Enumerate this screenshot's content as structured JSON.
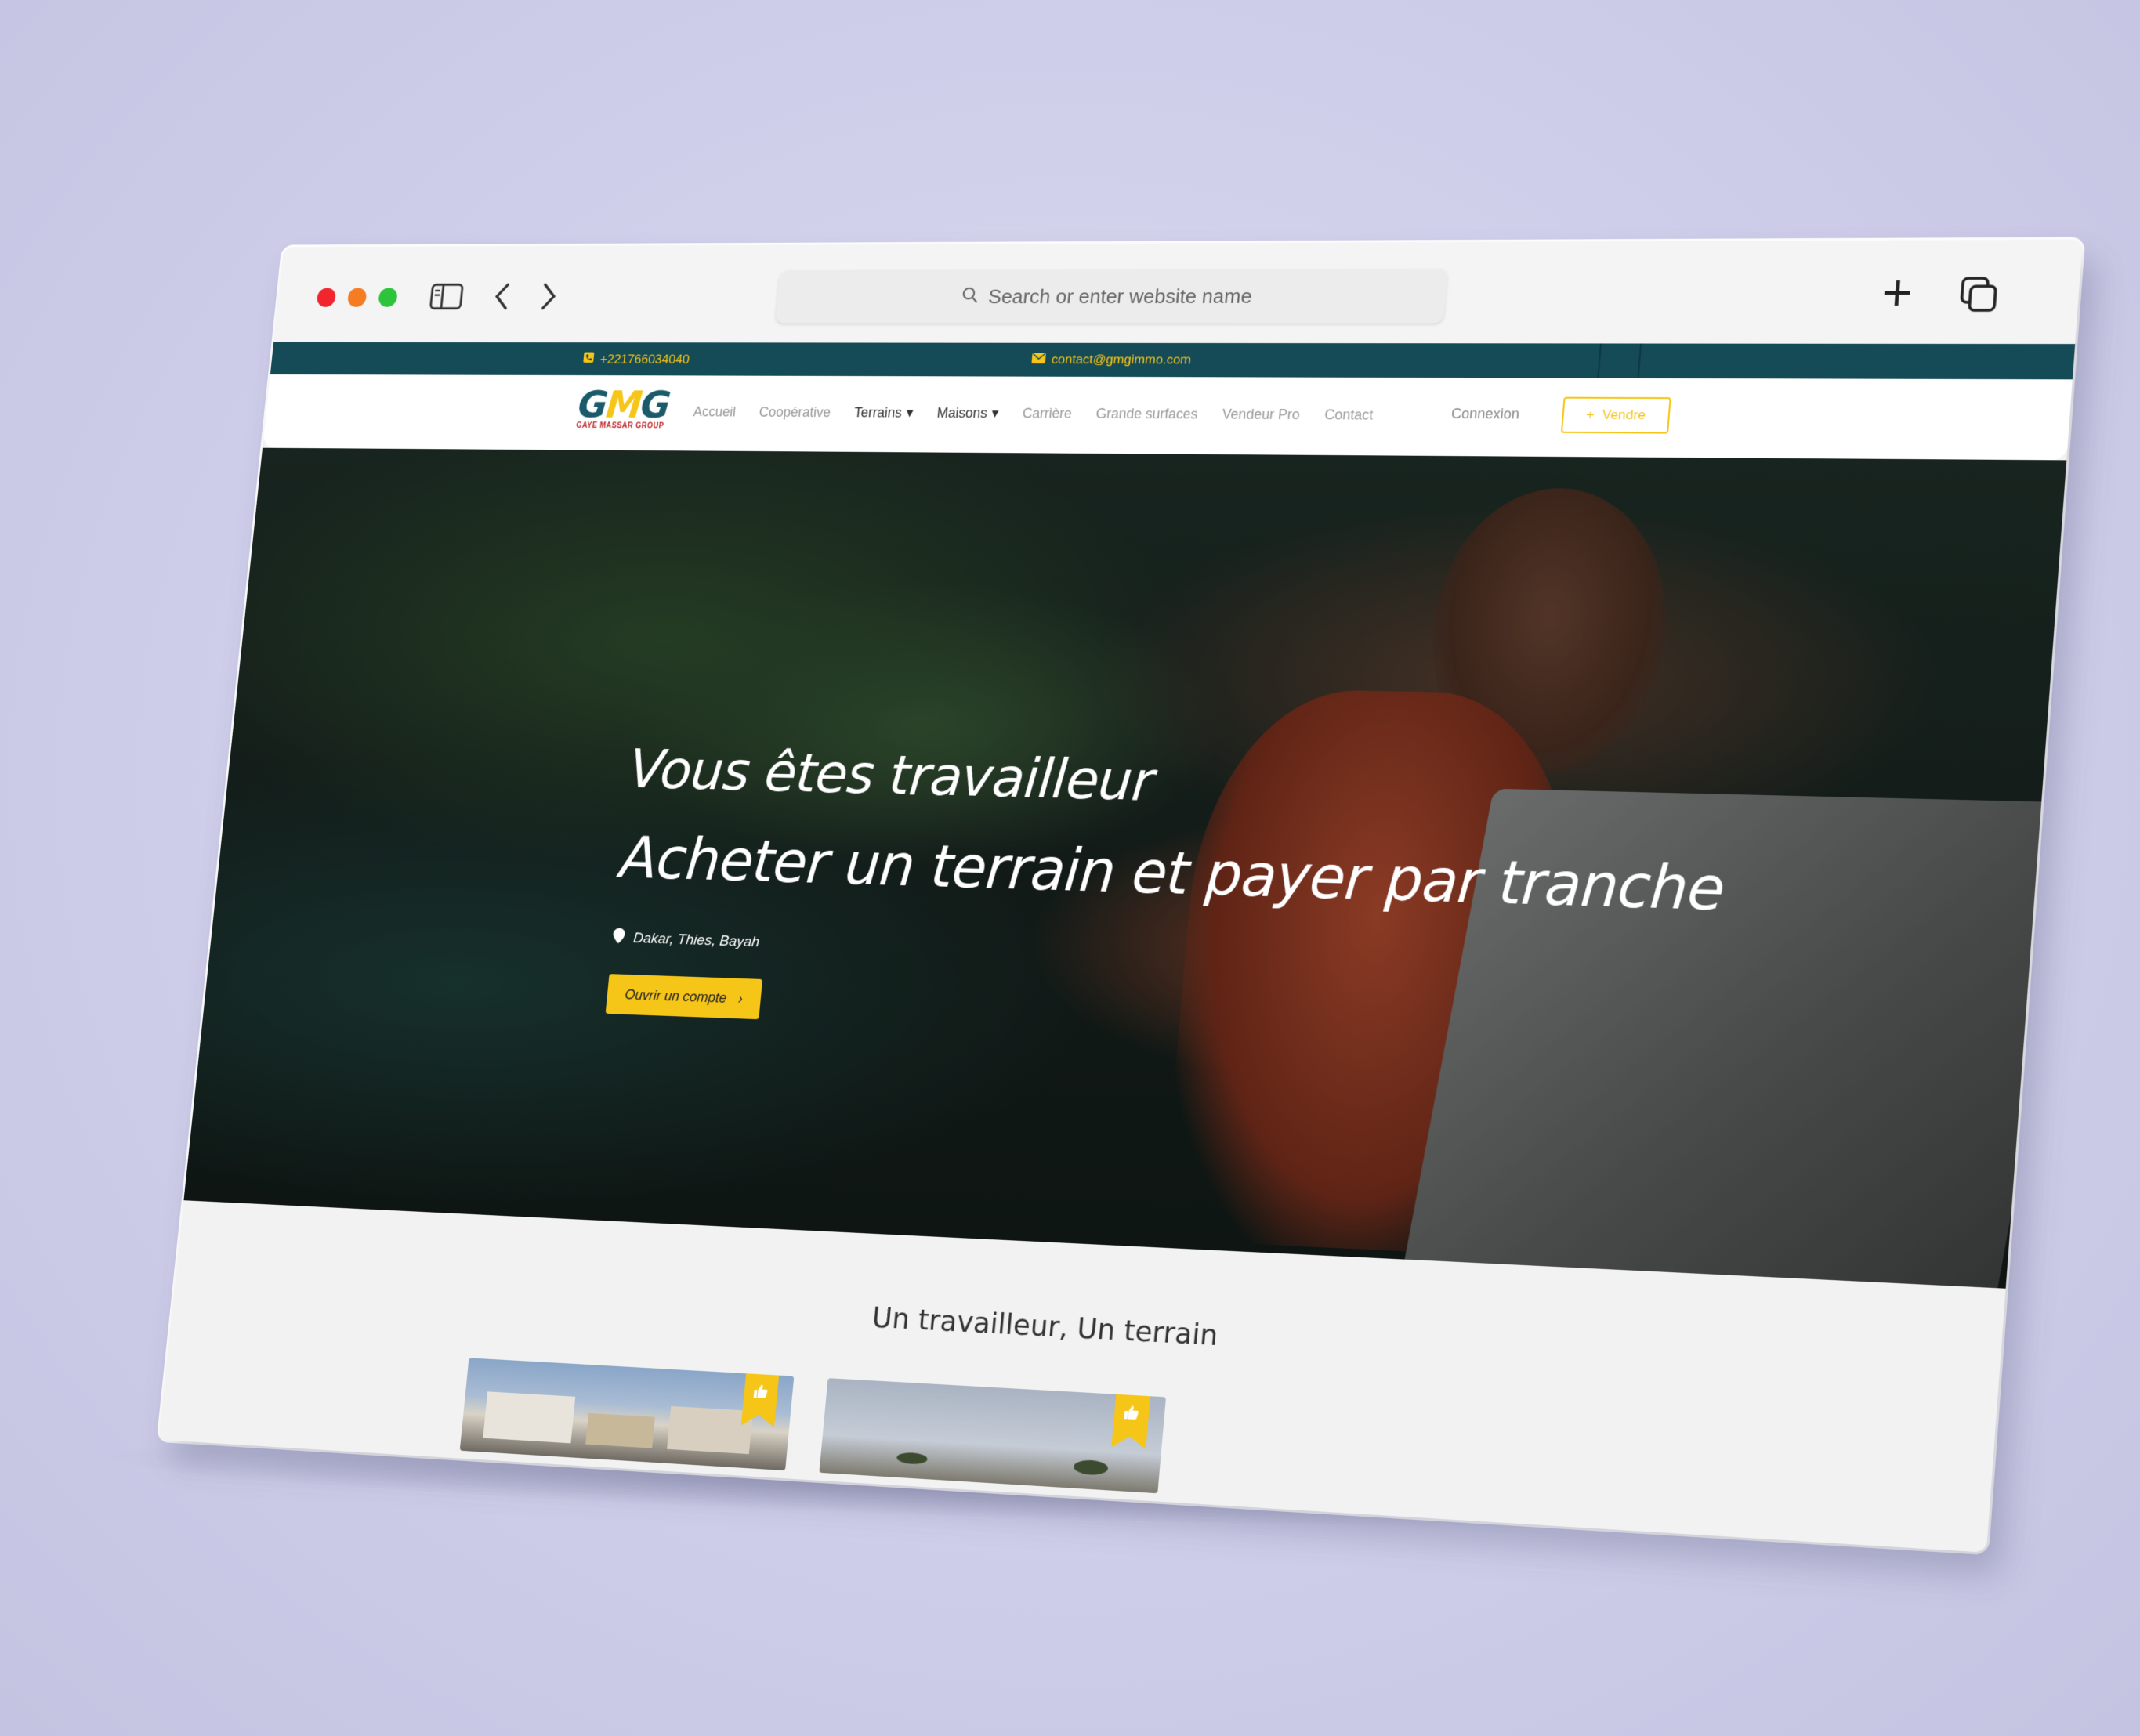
{
  "browser": {
    "search_placeholder": "Search or enter website name"
  },
  "topbar": {
    "phone": "+221766034040",
    "email": "contact@gmgimmo.com"
  },
  "logo": {
    "mark_g1": "G",
    "mark_m": "M",
    "mark_g2": "G",
    "tagline": "GAYE MASSAR GROUP"
  },
  "nav": {
    "items": [
      {
        "label": "Accueil"
      },
      {
        "label": "Coopérative"
      },
      {
        "label": "Terrains"
      },
      {
        "label": "Maisons"
      },
      {
        "label": "Carrière"
      },
      {
        "label": "Grande surfaces"
      },
      {
        "label": "Vendeur Pro"
      },
      {
        "label": "Contact"
      }
    ],
    "login": "Connexion",
    "sell": "Vendre"
  },
  "hero": {
    "line1": "Vous êtes travailleur",
    "line2": "Acheter un terrain et payer par tranche",
    "location": "Dakar, Thies, Bayah",
    "cta": "Ouvrir un compte"
  },
  "section": {
    "title": "Un travailleur, Un terrain"
  },
  "colors": {
    "brand_dark": "#154a57",
    "accent_yellow": "#f5c518",
    "logo_red": "#c0262c"
  },
  "icons": {
    "sidebar": "sidebar-icon",
    "back": "chevron-left-icon",
    "forward": "chevron-right-icon",
    "search": "search-icon",
    "new_tab": "plus-icon",
    "tabs": "tabs-icon",
    "phone": "phone-icon",
    "mail": "mail-icon",
    "location": "map-pin-icon",
    "thumbs_up": "thumbs-up-icon"
  }
}
